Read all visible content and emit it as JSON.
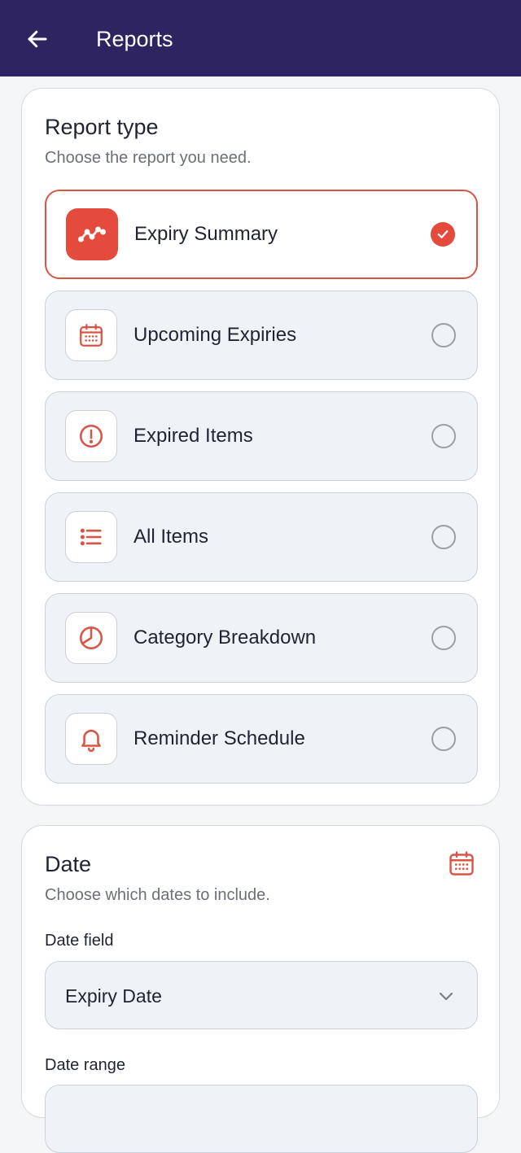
{
  "appbar": {
    "title": "Reports",
    "back_icon": "arrow-left-icon",
    "background": "#2e2461"
  },
  "report_type": {
    "title": "Report type",
    "subtitle": "Choose the report you need.",
    "options": [
      {
        "label": "Expiry Summary",
        "icon": "trend-line-icon",
        "selected": true
      },
      {
        "label": "Upcoming Expiries",
        "icon": "calendar-icon",
        "selected": false
      },
      {
        "label": "Expired Items",
        "icon": "alert-circle-icon",
        "selected": false
      },
      {
        "label": "All Items",
        "icon": "list-icon",
        "selected": false
      },
      {
        "label": "Category Breakdown",
        "icon": "pie-chart-icon",
        "selected": false
      },
      {
        "label": "Reminder Schedule",
        "icon": "bell-icon",
        "selected": false
      }
    ]
  },
  "date": {
    "title": "Date",
    "subtitle": "Choose which dates to include.",
    "icon": "calendar-icon",
    "date_field_label": "Date field",
    "date_field_value": "Expiry Date",
    "date_range_label": "Date range"
  },
  "colors": {
    "accent": "#e54b3d",
    "accent_border": "#d95444",
    "option_bg": "#eff2f6",
    "muted_text": "#6a6f7a"
  }
}
